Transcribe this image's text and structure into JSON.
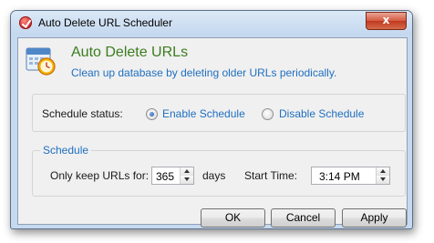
{
  "window": {
    "title": "Auto Delete URL Scheduler",
    "close_glyph": "x"
  },
  "header": {
    "icon": "calendar-clock-icon",
    "title": "Auto Delete URLs",
    "description": "Clean up database by deleting older URLs periodically."
  },
  "schedule_status": {
    "label": "Schedule status:",
    "options": [
      {
        "label": "Enable Schedule",
        "checked": true
      },
      {
        "label": "Disable Schedule",
        "checked": false
      }
    ]
  },
  "schedule": {
    "caption": "Schedule",
    "keep_label": "Only keep URLs for:",
    "keep_value": "365",
    "keep_unit": "days",
    "start_time_label": "Start Time:",
    "start_time_value": "3:14 PM"
  },
  "buttons": {
    "ok": "OK",
    "cancel": "Cancel",
    "apply": "Apply"
  },
  "colors": {
    "accent_green": "#3b7d1e",
    "accent_blue": "#1f6fc0",
    "window_frame": "#c6d9ef",
    "close_button": "#c9452a"
  }
}
